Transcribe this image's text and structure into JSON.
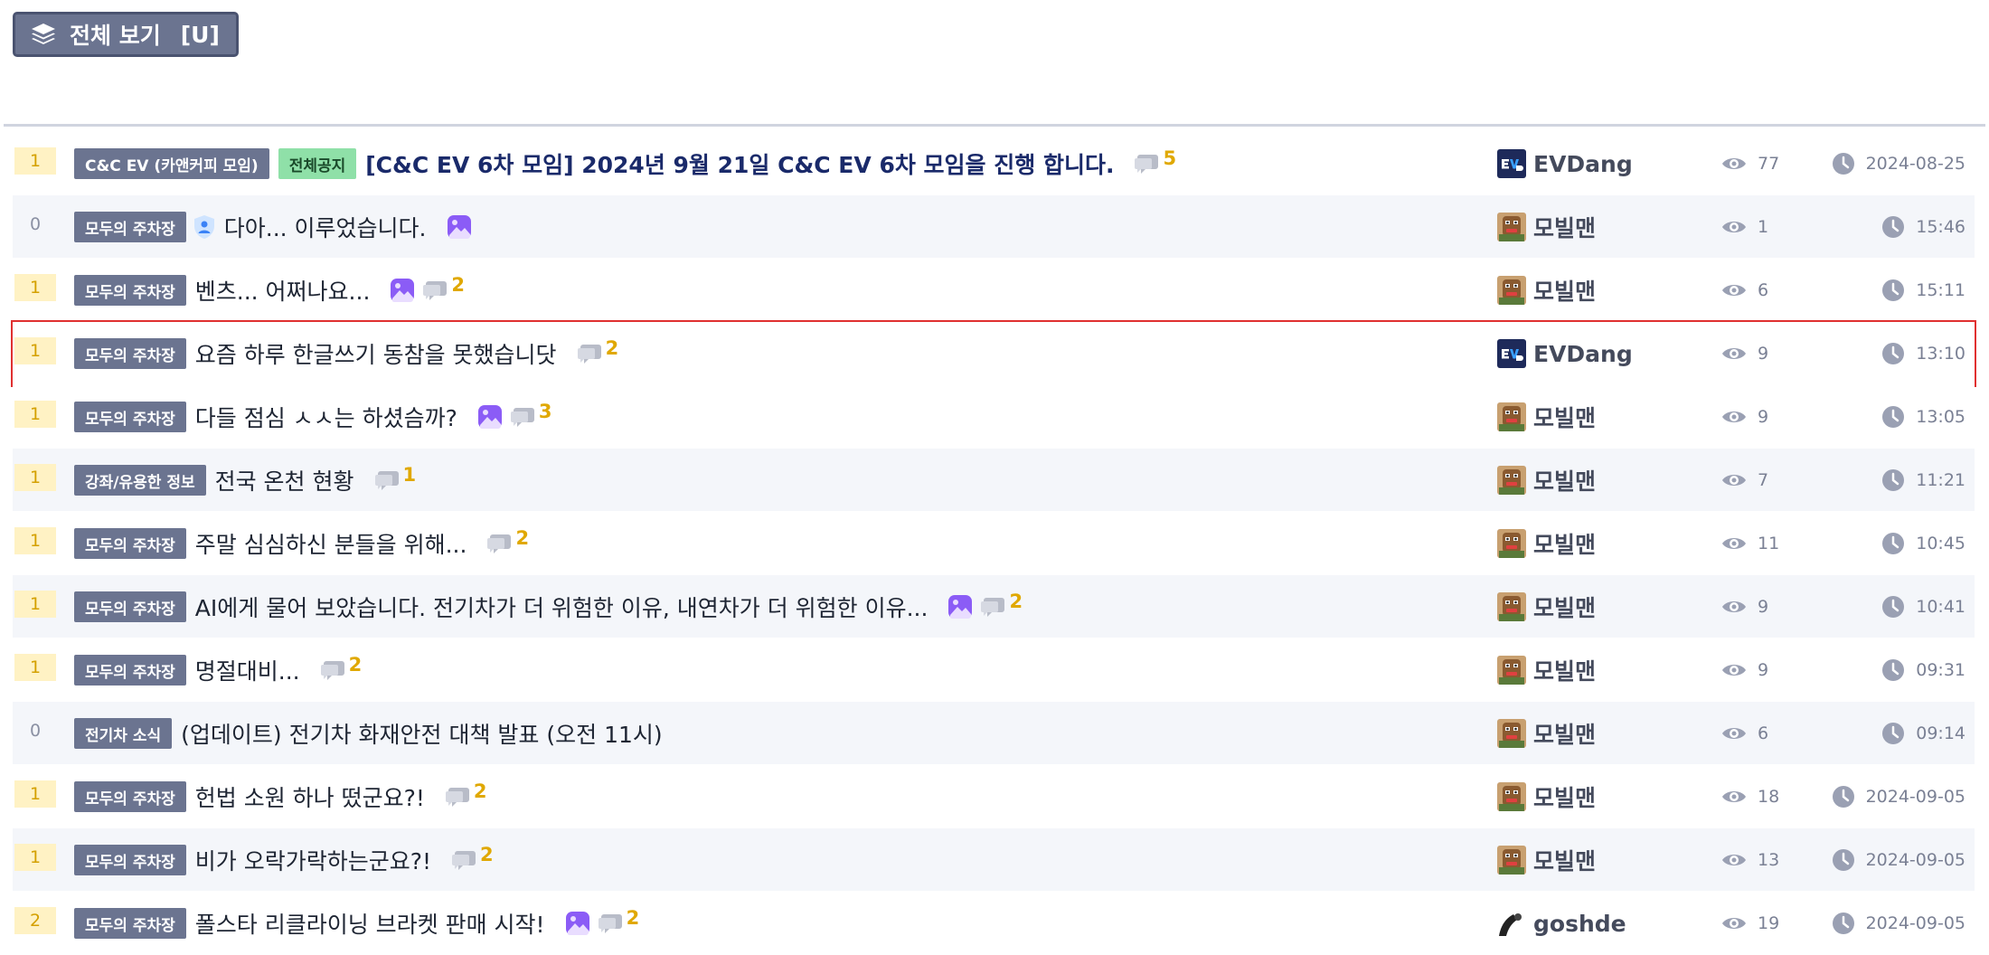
{
  "toolbar": {
    "view_all_label": "전체 보기",
    "view_all_shortcut": "[U]",
    "view_all_icon": "layers-icon"
  },
  "colors": {
    "badge_bg": "#6b7490",
    "notice_badge_bg": "#8fe0a8",
    "vote_bg": "#fff2c4",
    "comment_count": "#e0a800",
    "highlight_border": "#e03030"
  },
  "posts": [
    {
      "votes": "1",
      "category": "C&C EV (카앤커피 모임)",
      "notice": "전체공지",
      "title": "[C&C EV 6차 모임] 2024년 9월 21일 C&C EV 6차 모임을 진행 합니다.",
      "has_image": false,
      "has_secret": false,
      "comments": "5",
      "author": "EVDang",
      "avatar": "evdang",
      "views": "77",
      "date": "2024-08-25",
      "row_style": "plain"
    },
    {
      "votes": "0",
      "category": "모두의 주차장",
      "notice": "",
      "title": "다아... 이루었습니다.",
      "has_image": true,
      "has_secret": true,
      "comments": "",
      "author": "모빌맨",
      "avatar": "mobilman",
      "views": "1",
      "date": "15:46",
      "row_style": "alt"
    },
    {
      "votes": "1",
      "category": "모두의 주차장",
      "notice": "",
      "title": "벤츠... 어쩌나요...",
      "has_image": true,
      "has_secret": false,
      "comments": "2",
      "author": "모빌맨",
      "avatar": "mobilman",
      "views": "6",
      "date": "15:11",
      "row_style": "plain"
    },
    {
      "votes": "1",
      "category": "모두의 주차장",
      "notice": "",
      "title": "요즘 하루 한글쓰기 동참을 못했습니닷",
      "has_image": false,
      "has_secret": false,
      "comments": "2",
      "author": "EVDang",
      "avatar": "evdang",
      "views": "9",
      "date": "13:10",
      "row_style": "highlighted"
    },
    {
      "votes": "1",
      "category": "모두의 주차장",
      "notice": "",
      "title": "다들 점심 ㅅㅅ는 하셨슴까?",
      "has_image": true,
      "has_secret": false,
      "comments": "3",
      "author": "모빌맨",
      "avatar": "mobilman",
      "views": "9",
      "date": "13:05",
      "row_style": "plain"
    },
    {
      "votes": "1",
      "category": "강좌/유용한 정보",
      "notice": "",
      "title": "전국 온천 현황",
      "has_image": false,
      "has_secret": false,
      "comments": "1",
      "author": "모빌맨",
      "avatar": "mobilman",
      "views": "7",
      "date": "11:21",
      "row_style": "alt"
    },
    {
      "votes": "1",
      "category": "모두의 주차장",
      "notice": "",
      "title": "주말 심심하신 분들을 위해...",
      "has_image": false,
      "has_secret": false,
      "comments": "2",
      "author": "모빌맨",
      "avatar": "mobilman",
      "views": "11",
      "date": "10:45",
      "row_style": "plain"
    },
    {
      "votes": "1",
      "category": "모두의 주차장",
      "notice": "",
      "title": "AI에게 물어 보았습니다. 전기차가 더 위험한 이유, 내연차가 더 위험한 이유...",
      "has_image": true,
      "has_secret": false,
      "comments": "2",
      "author": "모빌맨",
      "avatar": "mobilman",
      "views": "9",
      "date": "10:41",
      "row_style": "alt"
    },
    {
      "votes": "1",
      "category": "모두의 주차장",
      "notice": "",
      "title": "명절대비...",
      "has_image": false,
      "has_secret": false,
      "comments": "2",
      "author": "모빌맨",
      "avatar": "mobilman",
      "views": "9",
      "date": "09:31",
      "row_style": "plain"
    },
    {
      "votes": "0",
      "category": "전기차 소식",
      "notice": "",
      "title": "(업데이트) 전기차 화재안전 대책 발표 (오전 11시)",
      "has_image": false,
      "has_secret": false,
      "comments": "",
      "author": "모빌맨",
      "avatar": "mobilman",
      "views": "6",
      "date": "09:14",
      "row_style": "alt"
    },
    {
      "votes": "1",
      "category": "모두의 주차장",
      "notice": "",
      "title": "헌법 소원 하나 떴군요?!",
      "has_image": false,
      "has_secret": false,
      "comments": "2",
      "author": "모빌맨",
      "avatar": "mobilman",
      "views": "18",
      "date": "2024-09-05",
      "row_style": "plain"
    },
    {
      "votes": "1",
      "category": "모두의 주차장",
      "notice": "",
      "title": "비가 오락가락하는군요?!",
      "has_image": false,
      "has_secret": false,
      "comments": "2",
      "author": "모빌맨",
      "avatar": "mobilman",
      "views": "13",
      "date": "2024-09-05",
      "row_style": "alt"
    },
    {
      "votes": "2",
      "category": "모두의 주차장",
      "notice": "",
      "title": "폴스타 리클라이닝 브라켓 판매 시작!",
      "has_image": true,
      "has_secret": false,
      "comments": "2",
      "author": "goshde",
      "avatar": "goshde",
      "views": "19",
      "date": "2024-09-05",
      "row_style": "plain"
    }
  ]
}
